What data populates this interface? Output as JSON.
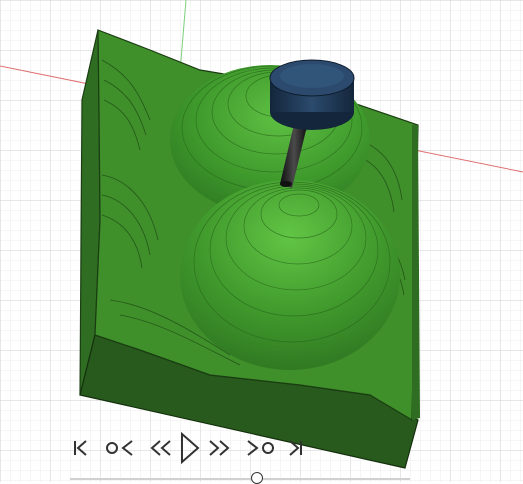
{
  "viewport": {
    "background": "#ffffff",
    "grid_color": "#d9d9d9",
    "x_axis_color": "#e06060",
    "y_axis_color": "#7ccf7c",
    "stock_color": "#3f8f2a",
    "stock_side_color": "#2f6e22",
    "stock_bottom_color": "#285a1d",
    "toolpath_line_color": "#1f4e16",
    "highlight_color": "#54b43a",
    "tool_holder_color": "#1f3550",
    "tool_shank_color": "#1a1a1a"
  },
  "playback": {
    "buttons": [
      {
        "name": "skip-to-start-button",
        "icon": "skip-start-icon"
      },
      {
        "name": "previous-operation-button",
        "icon": "previous-operation-icon"
      },
      {
        "name": "step-back-button",
        "icon": "rewind-icon"
      },
      {
        "name": "play-button",
        "icon": "play-icon"
      },
      {
        "name": "step-forward-button",
        "icon": "fast-forward-icon"
      },
      {
        "name": "next-operation-button",
        "icon": "next-operation-icon"
      },
      {
        "name": "skip-to-end-button",
        "icon": "skip-end-icon"
      }
    ],
    "icon_color": "#333333",
    "progress_fraction": 0.55
  }
}
